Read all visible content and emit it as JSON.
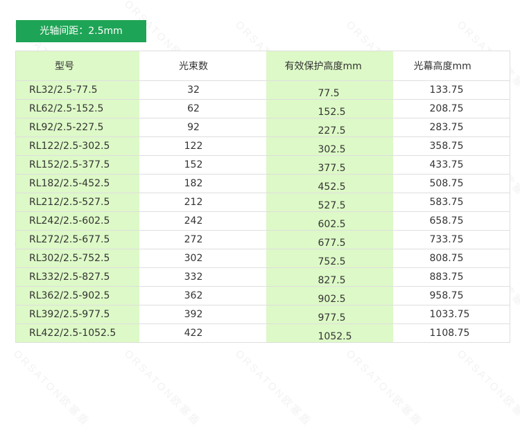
{
  "header": {
    "title": "光轴间距：2.5mm"
  },
  "watermark": "ORSATON欧塞盾",
  "colors": {
    "title_bg": "#1ea456",
    "highlight_column_bg": "#ddf9c7"
  },
  "table": {
    "columns": [
      "型号",
      "光束数",
      "有效保护高度mm",
      "光幕高度mm"
    ],
    "rows": [
      [
        "RL32/2.5-77.5",
        "32",
        "77.5",
        "133.75"
      ],
      [
        "RL62/2.5-152.5",
        "62",
        "152.5",
        "208.75"
      ],
      [
        "RL92/2.5-227.5",
        "92",
        "227.5",
        "283.75"
      ],
      [
        "RL122/2.5-302.5",
        "122",
        "302.5",
        "358.75"
      ],
      [
        "RL152/2.5-377.5",
        "152",
        "377.5",
        "433.75"
      ],
      [
        "RL182/2.5-452.5",
        "182",
        "452.5",
        "508.75"
      ],
      [
        "RL212/2.5-527.5",
        "212",
        "527.5",
        "583.75"
      ],
      [
        "RL242/2.5-602.5",
        "242",
        "602.5",
        "658.75"
      ],
      [
        "RL272/2.5-677.5",
        "272",
        "677.5",
        "733.75"
      ],
      [
        "RL302/2.5-752.5",
        "302",
        "752.5",
        "808.75"
      ],
      [
        "RL332/2.5-827.5",
        "332",
        "827.5",
        "883.75"
      ],
      [
        "RL362/2.5-902.5",
        "362",
        "902.5",
        "958.75"
      ],
      [
        "RL392/2.5-977.5",
        "392",
        "977.5",
        "1033.75"
      ],
      [
        "RL422/2.5-1052.5",
        "422",
        "1052.5",
        "1108.75"
      ]
    ]
  }
}
